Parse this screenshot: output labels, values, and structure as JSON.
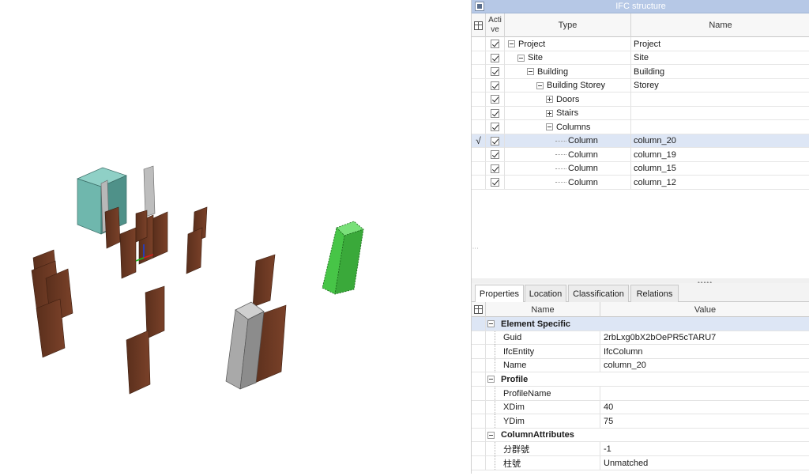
{
  "ifc_panel": {
    "title": "IFC structure",
    "columns": {
      "active": "Acti\nve",
      "type": "Type",
      "name": "Name"
    },
    "rows": [
      {
        "type": "Project",
        "name": "Project",
        "level": 0,
        "expander": "minus",
        "checked": true,
        "selected": false
      },
      {
        "type": "Site",
        "name": "Site",
        "level": 1,
        "expander": "minus",
        "checked": true,
        "selected": false
      },
      {
        "type": "Building",
        "name": "Building",
        "level": 2,
        "expander": "minus",
        "checked": true,
        "selected": false
      },
      {
        "type": "Building Storey",
        "name": "Storey",
        "level": 3,
        "expander": "minus",
        "checked": true,
        "selected": false
      },
      {
        "type": "Doors",
        "name": "",
        "level": 4,
        "expander": "plus",
        "checked": true,
        "selected": false
      },
      {
        "type": "Stairs",
        "name": "",
        "level": 4,
        "expander": "plus",
        "checked": true,
        "selected": false
      },
      {
        "type": "Columns",
        "name": "",
        "level": 4,
        "expander": "minus",
        "checked": true,
        "selected": false
      },
      {
        "type": "Column",
        "name": "column_20",
        "level": 5,
        "expander": "leaf",
        "checked": true,
        "selected": true
      },
      {
        "type": "Column",
        "name": "column_19",
        "level": 5,
        "expander": "leaf",
        "checked": true,
        "selected": false
      },
      {
        "type": "Column",
        "name": "column_15",
        "level": 5,
        "expander": "leaf",
        "checked": true,
        "selected": false
      },
      {
        "type": "Column",
        "name": "column_12",
        "level": 5,
        "expander": "leaf",
        "checked": true,
        "selected": false
      }
    ],
    "selected_marker": "√"
  },
  "tabs": [
    {
      "label": "Properties",
      "active": true
    },
    {
      "label": "Location",
      "active": false
    },
    {
      "label": "Classification",
      "active": false
    },
    {
      "label": "Relations",
      "active": false
    }
  ],
  "property_grid": {
    "columns": {
      "name": "Name",
      "value": "Value"
    },
    "rows": [
      {
        "kind": "category",
        "name": "Element Specific",
        "highlight": true
      },
      {
        "kind": "prop",
        "name": "Guid",
        "value": "2rbLxg0bX2bOePR5cTARU7"
      },
      {
        "kind": "prop",
        "name": "IfcEntity",
        "value": "IfcColumn"
      },
      {
        "kind": "prop",
        "name": "Name",
        "value": "column_20"
      },
      {
        "kind": "category",
        "name": "Profile",
        "highlight": false
      },
      {
        "kind": "prop",
        "name": "ProfileName",
        "value": ""
      },
      {
        "kind": "prop",
        "name": "XDim",
        "value": "40"
      },
      {
        "kind": "prop",
        "name": "YDim",
        "value": "75"
      },
      {
        "kind": "category",
        "name": "ColumnAttributes",
        "highlight": false
      },
      {
        "kind": "prop",
        "name": "分群號",
        "value": "-1"
      },
      {
        "kind": "prop",
        "name": "柱號",
        "value": "Unmatched"
      }
    ]
  },
  "colors": {
    "titlebar": "#b6c8e6",
    "selection": "#dde6f5",
    "door": "#6b3a24",
    "column_gray": "#a9a9a9",
    "column_teal": "#6fb7ad",
    "column_selected": "#3fbf3f"
  }
}
